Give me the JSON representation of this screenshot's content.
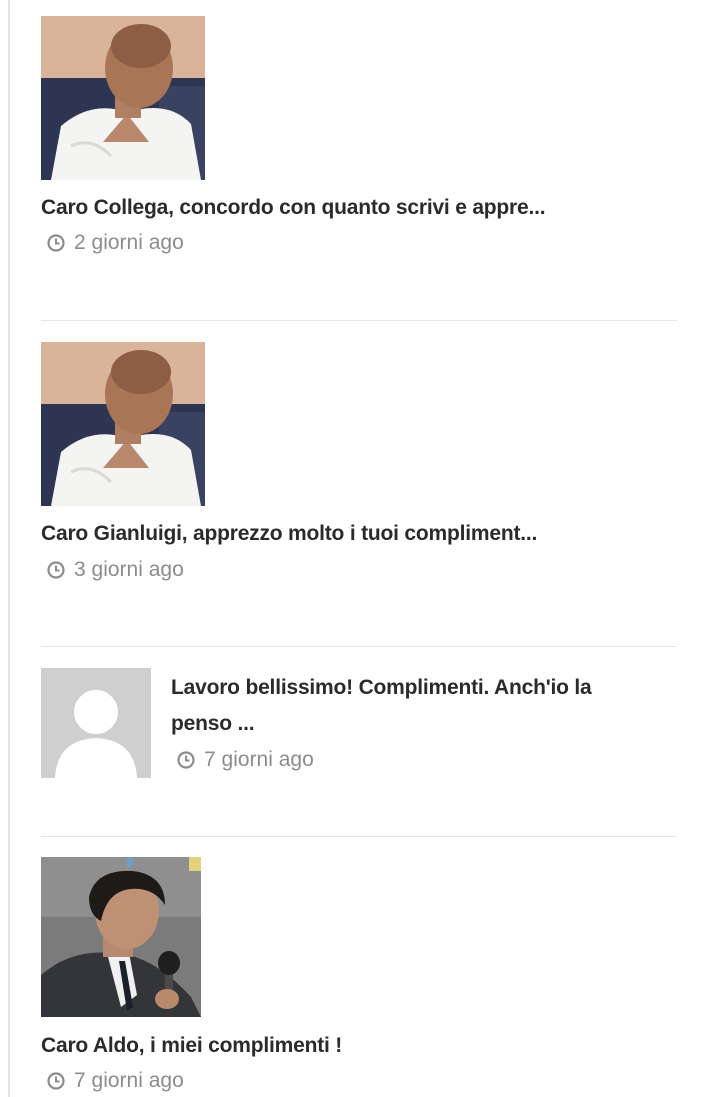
{
  "comments": [
    {
      "avatar": "user-photo-man-white-shirt",
      "text": "Caro Collega, concordo con quanto scrivi e appre...",
      "time_icon": "clock-icon",
      "time": "2 giorni ago"
    },
    {
      "avatar": "user-photo-man-white-shirt",
      "text": "Caro Gianluigi, apprezzo molto i tuoi compliment...",
      "time_icon": "clock-icon",
      "time": "3 giorni ago"
    },
    {
      "avatar": "default-avatar-placeholder",
      "text_line1": "Lavoro bellissimo! Complimenti. Anch'io la",
      "text_line2": "penso ...",
      "time_icon": "clock-icon",
      "time": "7 giorni ago"
    },
    {
      "avatar": "user-photo-man-with-microphone",
      "text": "Caro Aldo, i miei complimenti !",
      "time_icon": "clock-icon",
      "time": "7 giorni ago"
    }
  ]
}
